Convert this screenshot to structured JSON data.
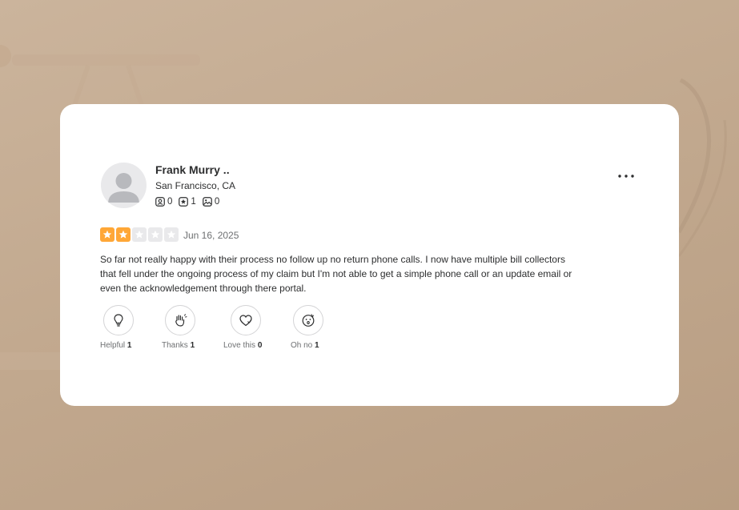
{
  "review": {
    "user": {
      "name": "Frank Murry ..",
      "location": "San Francisco, CA",
      "stats": [
        {
          "icon": "friends-icon",
          "count": "0"
        },
        {
          "icon": "reviews-icon",
          "count": "1"
        },
        {
          "icon": "photos-icon",
          "count": "0"
        }
      ]
    },
    "rating": 2,
    "rating_max": 5,
    "date": "Jun 16, 2025",
    "text": "So far not really happy with their process no follow up no return phone calls. I now have multiple bill collectors that fell under the ongoing process of my claim but I'm not able to get a simple phone call or an update email or even the acknowledgement through there portal.",
    "reactions": [
      {
        "label": "Helpful",
        "count": "1",
        "icon": "lightbulb-icon"
      },
      {
        "label": "Thanks",
        "count": "1",
        "icon": "clapping-hands-icon"
      },
      {
        "label": "Love this",
        "count": "0",
        "icon": "heart-icon"
      },
      {
        "label": "Oh no",
        "count": "1",
        "icon": "surprised-face-icon"
      }
    ]
  },
  "colors": {
    "star_on": "#ffa737",
    "star_off": "#e9e9eb",
    "background": "#c2a98f"
  }
}
